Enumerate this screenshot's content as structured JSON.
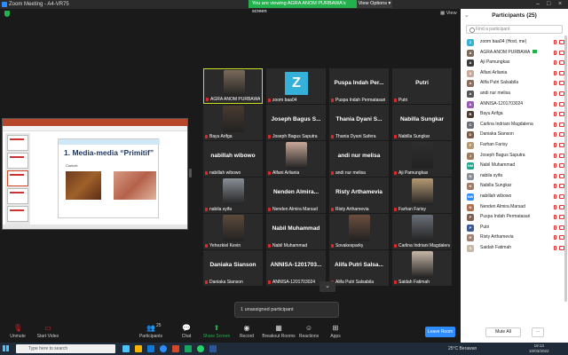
{
  "window": {
    "title": "Zoom Meeting - A4-VR75",
    "banner": "You are viewing AGRA ANOM PURBAWA's screen",
    "view_options": "View Options",
    "view_label": "View"
  },
  "grid": {
    "tiles": [
      {
        "label": "AGRA ANOM PURBAWA",
        "kind": "photo",
        "color": "#7a6a5a",
        "active": true
      },
      {
        "label": "zoom baa04",
        "kind": "avatar",
        "initial": "Z"
      },
      {
        "label": "Puspa Indah Permatasari",
        "kind": "text",
        "big": "Puspa Indah Per..."
      },
      {
        "label": "Putri",
        "kind": "text",
        "big": "Putri"
      },
      {
        "label": "Bayu Arifga",
        "kind": "photo",
        "color": "#4a3b30"
      },
      {
        "label": "Joseph Bagus Saputra",
        "kind": "text",
        "big": "Joseph Bagus S..."
      },
      {
        "label": "Thania Dyani Safera",
        "kind": "text",
        "big": "Thania Dyani S..."
      },
      {
        "label": "Nabilla Sungkar",
        "kind": "text",
        "big": "Nabilla Sungkar"
      },
      {
        "label": "nabillah wibowo",
        "kind": "text",
        "big": "nabillah wibowo"
      },
      {
        "label": "Alfani Arliania",
        "kind": "photo",
        "color": "#c9a99a"
      },
      {
        "label": "andi nur melisa",
        "kind": "text",
        "big": "andi nur melisa"
      },
      {
        "label": "Aji Pamungkas",
        "kind": "photo",
        "color": "#2f2f2f"
      },
      {
        "label": "nabila syifa",
        "kind": "photo",
        "color": "#8a8f96"
      },
      {
        "label": "Nenden Almira Marsad",
        "kind": "text",
        "big": "Nenden Almira..."
      },
      {
        "label": "Risty Arthamevia",
        "kind": "text",
        "big": "Risty Arthamevia"
      },
      {
        "label": "Farhan Farisy",
        "kind": "photo",
        "color": "#b59a74"
      },
      {
        "label": "Yehezkiel Kevin",
        "kind": "photo",
        "color": "#5c4a3a"
      },
      {
        "label": "Nabil Muhammad",
        "kind": "text",
        "big": "Nabil Muhammad"
      },
      {
        "label": "Sovakesparky",
        "kind": "photo",
        "color": "#6b4e3e"
      },
      {
        "label": "Carlina Indriani Magdalena",
        "kind": "photo",
        "color": "#6a6f78"
      },
      {
        "label": "Daniaka Sianson",
        "kind": "text",
        "big": "Daniaka Sianson"
      },
      {
        "label": "ANNISA-1201703024",
        "kind": "text",
        "big": "ANNISA-1201703..."
      },
      {
        "label": "Alifa Putri Salsabila",
        "kind": "text",
        "big": "Alifa Putri Salsa..."
      },
      {
        "label": "Saidah Fatimah",
        "kind": "photo",
        "color": "#c7b8a8"
      }
    ]
  },
  "slide": {
    "title": "1. Media-media “Primitif”",
    "caption": "Contoh:"
  },
  "toast": "1 unassigned participant",
  "toolbar": {
    "unmute": "Unmute",
    "start_video": "Start Video",
    "participants": "Participants",
    "participants_count": "25",
    "chat": "Chat",
    "share_screen": "Share Screen",
    "record": "Record",
    "breakout_rooms": "Breakout Rooms",
    "reactions": "Reactions",
    "apps": "Apps",
    "leave_room": "Leave Room"
  },
  "panel": {
    "title": "Participants (25)",
    "search_placeholder": "Find a participant",
    "mute_all": "Mute All",
    "more": "...",
    "participants": [
      {
        "name": "zoom baa04 (Host, me)",
        "initial": "Z",
        "color": "#35b0d8"
      },
      {
        "name": "AGRA ANOM PURBAWA",
        "initial": "A",
        "color": "#7a6a5a",
        "host": true
      },
      {
        "name": "Aji Pamungkas",
        "initial": "A",
        "color": "#3a3a3a"
      },
      {
        "name": "Alfani Arliania",
        "initial": "A",
        "color": "#c9a99a"
      },
      {
        "name": "Alifa Putri Salsabila",
        "initial": "A",
        "color": "#8c6a5a"
      },
      {
        "name": "andi nur melisa",
        "initial": "A",
        "color": "#555555"
      },
      {
        "name": "ANNISA-1201703024",
        "initial": "A",
        "color": "#9b59b6"
      },
      {
        "name": "Bayu Arifga",
        "initial": "B",
        "color": "#4a3b30"
      },
      {
        "name": "Carlina Indriani Magdalena",
        "initial": "C",
        "color": "#6a6f78"
      },
      {
        "name": "Daniaka Sianson",
        "initial": "D",
        "color": "#7d5a44"
      },
      {
        "name": "Farhan Farisy",
        "initial": "F",
        "color": "#b59a74"
      },
      {
        "name": "Joseph Bagus Saputra",
        "initial": "J",
        "color": "#9c7b5a"
      },
      {
        "name": "Nabil Muhammad",
        "initial": "NM",
        "color": "#1fa38a"
      },
      {
        "name": "nabila syifa",
        "initial": "N",
        "color": "#8a8f96"
      },
      {
        "name": "Nabilla Sungkar",
        "initial": "N",
        "color": "#a07860"
      },
      {
        "name": "nabillah wibowo",
        "initial": "NW",
        "color": "#2d8cff"
      },
      {
        "name": "Nenden Almira Marsad",
        "initial": "N",
        "color": "#b07050"
      },
      {
        "name": "Puspa Indah Permatasari",
        "initial": "P",
        "color": "#806050"
      },
      {
        "name": "Putri",
        "initial": "P",
        "color": "#3b5998"
      },
      {
        "name": "Risty Arthamevia",
        "initial": "R",
        "color": "#a08070"
      },
      {
        "name": "Saidah Fatimah",
        "initial": "S",
        "color": "#c7b8a8"
      }
    ]
  },
  "taskbar": {
    "search": "Type here to search",
    "weather": "25°C  Berawan",
    "time": "19:13",
    "date": "10/03/2022"
  }
}
